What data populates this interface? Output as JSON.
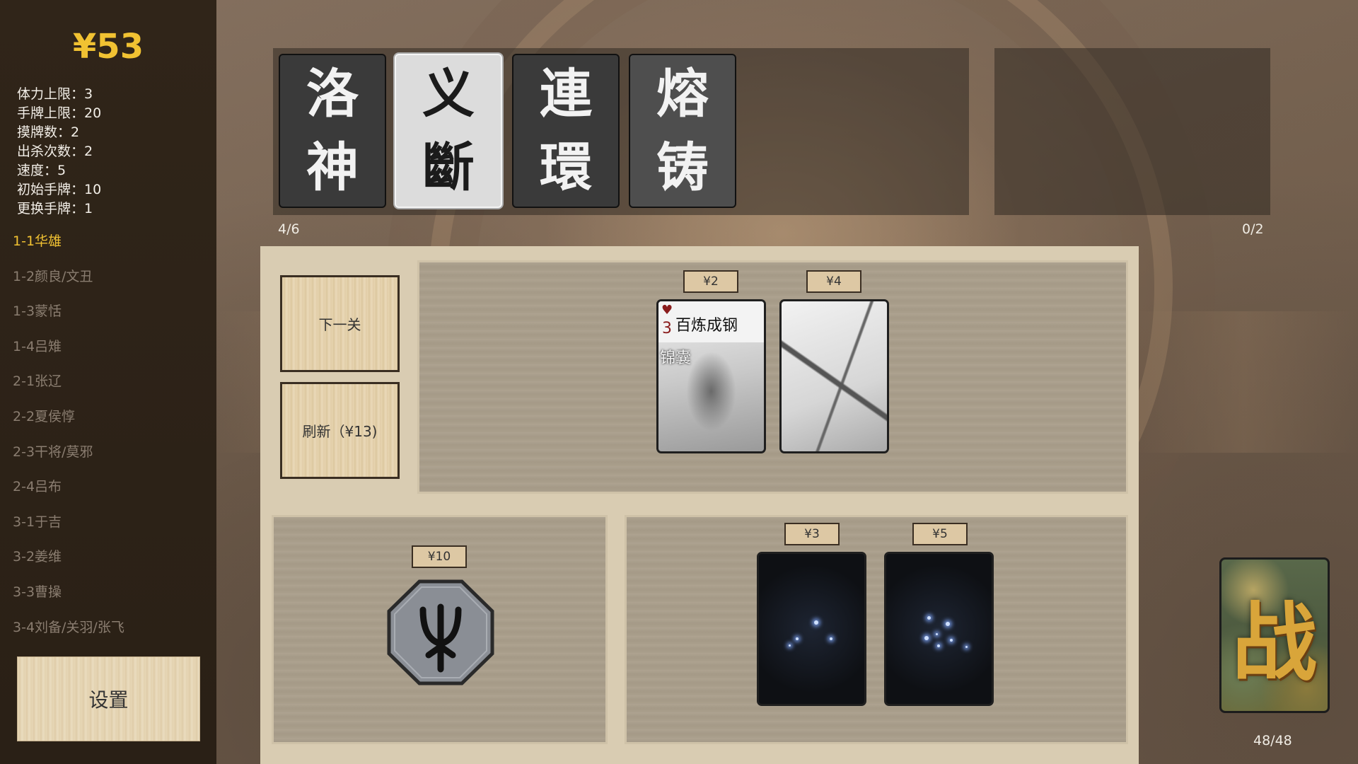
{
  "money": "¥53",
  "stats": [
    "体力上限：3",
    "手牌上限：20",
    "摸牌数：2",
    "出杀次数：2",
    "速度：5",
    "初始手牌：10",
    "更换手牌：1"
  ],
  "stages": [
    {
      "label": "1-1华雄",
      "active": true
    },
    {
      "label": "1-2颜良/文丑",
      "active": false
    },
    {
      "label": "1-3蒙恬",
      "active": false
    },
    {
      "label": "1-4吕雉",
      "active": false
    },
    {
      "label": "2-1张辽",
      "active": false
    },
    {
      "label": "2-2夏侯惇",
      "active": false
    },
    {
      "label": "2-3干将/莫邪",
      "active": false
    },
    {
      "label": "2-4吕布",
      "active": false
    },
    {
      "label": "3-1于吉",
      "active": false
    },
    {
      "label": "3-2姜维",
      "active": false
    },
    {
      "label": "3-3曹操",
      "active": false
    },
    {
      "label": "3-4刘备/关羽/张飞",
      "active": false
    }
  ],
  "settings_label": "设置",
  "heroes": [
    {
      "line1": "洛",
      "line2": "神",
      "style": "dark"
    },
    {
      "line1": "义",
      "line2": "斷",
      "style": "light"
    },
    {
      "line1": "連",
      "line2": "環",
      "style": "dark"
    },
    {
      "line1": "熔",
      "line2": "铸",
      "style": "gray"
    }
  ],
  "hero_count": "4/6",
  "item_count": "0/2",
  "buttons": {
    "next_level": "下一关",
    "refresh": "刷新（¥13)"
  },
  "shop_cards": [
    {
      "price": "¥2",
      "name": "百炼成钢",
      "suit": "♥",
      "number": "3",
      "tag": "锦囊"
    },
    {
      "price": "¥4"
    }
  ],
  "relic": {
    "price": "¥10",
    "icon": "trident-rune-icon"
  },
  "star_cards": [
    {
      "price": "¥3"
    },
    {
      "price": "¥5"
    }
  ],
  "deck": {
    "glyph": "战",
    "count": "48/48"
  }
}
